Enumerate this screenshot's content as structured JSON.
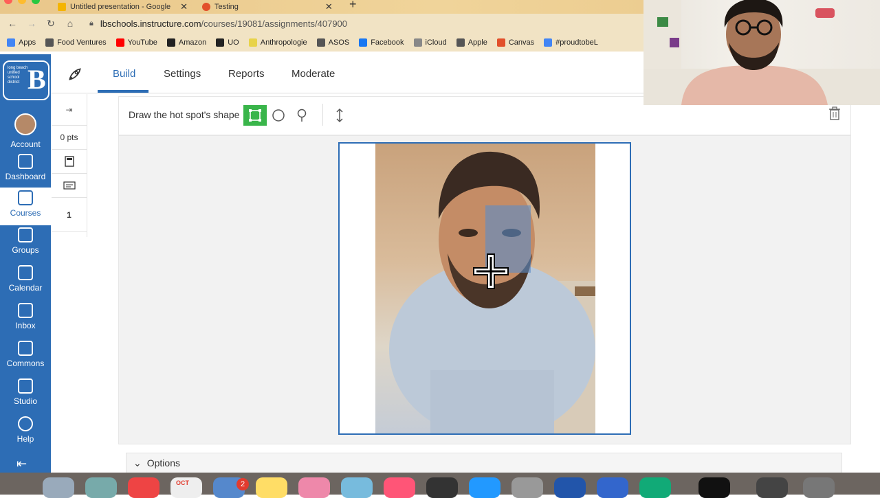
{
  "browser": {
    "tabs": [
      {
        "label": "Untitled presentation - Google",
        "favicon_color": "#f4b400"
      },
      {
        "label": "Testing",
        "favicon_color": "#e2502b"
      }
    ],
    "url_host": "lbschools.instructure.com",
    "url_path": "/courses/19081/assignments/407900",
    "bookmarks": [
      {
        "label": "Apps",
        "icon": "apps-grid-icon",
        "color": "#4285f4"
      },
      {
        "label": "Food Ventures",
        "icon": "folder-icon",
        "color": "#555555"
      },
      {
        "label": "YouTube",
        "icon": "youtube-icon",
        "color": "#ff0000"
      },
      {
        "label": "Amazon",
        "icon": "amazon-icon",
        "color": "#222222"
      },
      {
        "label": "UO",
        "icon": "uo-icon",
        "color": "#222222"
      },
      {
        "label": "Anthropologie",
        "icon": "anthropologie-icon",
        "color": "#e8d34a"
      },
      {
        "label": "ASOS",
        "icon": "globe-icon",
        "color": "#555555"
      },
      {
        "label": "Facebook",
        "icon": "facebook-icon",
        "color": "#1877f2"
      },
      {
        "label": "iCloud",
        "icon": "apple-icon",
        "color": "#888888"
      },
      {
        "label": "Apple",
        "icon": "globe-icon",
        "color": "#555555"
      },
      {
        "label": "Canvas",
        "icon": "canvas-icon",
        "color": "#e2502b"
      },
      {
        "label": "#proudtobeL",
        "icon": "google-icon",
        "color": "#4285f4"
      }
    ]
  },
  "logo_text": "long beach unified school district",
  "global_nav": [
    {
      "label": "Account",
      "icon": "avatar-icon"
    },
    {
      "label": "Dashboard",
      "icon": "dashboard-icon"
    },
    {
      "label": "Courses",
      "icon": "courses-icon",
      "active": true
    },
    {
      "label": "Groups",
      "icon": "groups-icon"
    },
    {
      "label": "Calendar",
      "icon": "calendar-icon"
    },
    {
      "label": "Inbox",
      "icon": "inbox-icon"
    },
    {
      "label": "Commons",
      "icon": "commons-icon"
    },
    {
      "label": "Studio",
      "icon": "studio-icon"
    },
    {
      "label": "Help",
      "icon": "help-icon"
    }
  ],
  "top_tabs": [
    "Build",
    "Settings",
    "Reports",
    "Moderate"
  ],
  "left_strip": {
    "points": "0 pts",
    "number": "1"
  },
  "hotspot_toolbar": {
    "label": "Draw the hot spot's shape",
    "shapes": [
      "rectangle",
      "circle",
      "pin"
    ]
  },
  "options_label": "Options",
  "dock": {
    "calendar_month": "OCT",
    "badge_count": "2",
    "icon_colors": [
      "#9ab",
      "#7aa",
      "#e44",
      "#eee",
      "#58c",
      "#fd6",
      "#e8a",
      "#7bd",
      "#f57",
      "#333",
      "#29f",
      "#999",
      "#25a",
      "#36c",
      "#1a7",
      "#111",
      "#444",
      "#777"
    ]
  }
}
